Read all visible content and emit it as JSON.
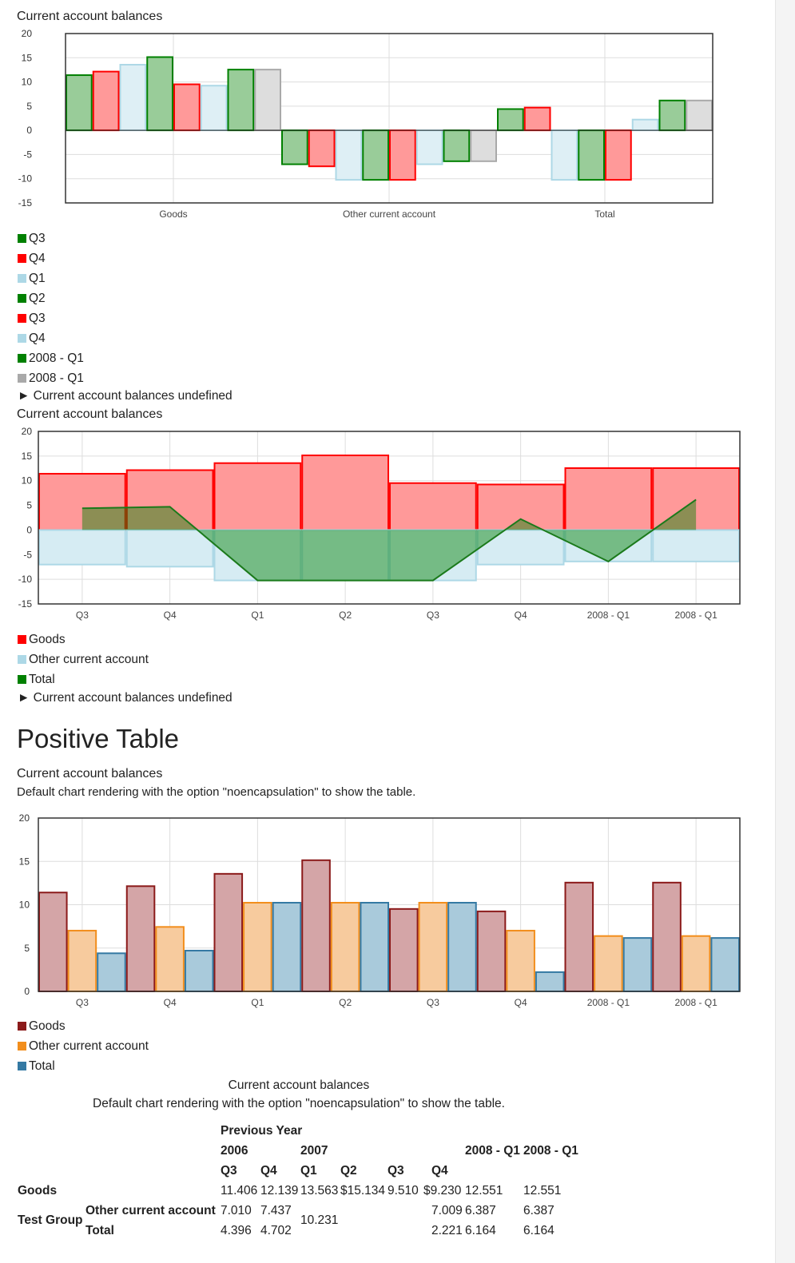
{
  "chart_data": [
    {
      "type": "bar",
      "title": "Current account balances",
      "categories": [
        "Goods",
        "Other current account",
        "Total"
      ],
      "series": [
        {
          "name": "Q3",
          "color": "#008000",
          "values": [
            11.406,
            -7.01,
            4.396
          ]
        },
        {
          "name": "Q4",
          "color": "#ff0000",
          "values": [
            12.139,
            -7.437,
            4.702
          ]
        },
        {
          "name": "Q1",
          "color": "#add8e6",
          "values": [
            13.563,
            -10.231,
            -10.231
          ]
        },
        {
          "name": "Q2",
          "color": "#008000",
          "values": [
            15.134,
            -10.231,
            -10.231
          ]
        },
        {
          "name": "Q3",
          "color": "#ff0000",
          "values": [
            9.51,
            -10.231,
            -10.231
          ]
        },
        {
          "name": "Q4",
          "color": "#add8e6",
          "values": [
            9.23,
            -7.009,
            2.221
          ]
        },
        {
          "name": "2008 - Q1",
          "color": "#008000",
          "values": [
            12.551,
            -6.387,
            6.164
          ]
        },
        {
          "name": "2008 - Q1",
          "color": "#a9a9a9",
          "values": [
            12.551,
            -6.387,
            6.164
          ]
        }
      ],
      "ylim": [
        -15,
        20
      ],
      "yticks": [
        20,
        15,
        10,
        5,
        0,
        -5,
        -10,
        -15
      ],
      "grid": true,
      "legend": "below",
      "undefined_label": "► Current account balances undefined"
    },
    {
      "type": "bar",
      "title": "Current account balances",
      "categories": [
        "Q3",
        "Q4",
        "Q1",
        "Q2",
        "Q3",
        "Q4",
        "2008 - Q1",
        "2008 - Q1"
      ],
      "series": [
        {
          "name": "Goods",
          "kind": "bar",
          "color": "#ff0000",
          "values": [
            11.406,
            12.139,
            13.563,
            15.134,
            9.51,
            9.23,
            12.551,
            12.551
          ]
        },
        {
          "name": "Other current account",
          "kind": "bar",
          "color": "#add8e6",
          "values": [
            -7.01,
            -7.437,
            -10.231,
            -10.231,
            -10.231,
            -7.009,
            -6.387,
            -6.387
          ]
        },
        {
          "name": "Total",
          "kind": "area",
          "color": "#008000",
          "values": [
            4.396,
            4.702,
            -10.231,
            -10.231,
            -10.231,
            2.221,
            -6.387,
            6.164
          ]
        }
      ],
      "ylim": [
        -15,
        20
      ],
      "yticks": [
        20,
        15,
        10,
        5,
        0,
        -5,
        -10,
        -15
      ],
      "grid": true,
      "legend": "below",
      "undefined_label": "► Current account balances undefined"
    },
    {
      "type": "bar",
      "title": "Current account balances",
      "subtitle": "Default chart rendering with the option \"noencapsulation\" to show the table.",
      "categories": [
        "Q3",
        "Q4",
        "Q1",
        "Q2",
        "Q3",
        "Q4",
        "2008 - Q1",
        "2008 - Q1"
      ],
      "series": [
        {
          "name": "Goods",
          "color": "#8b1a1a",
          "fill": "#d4a5a7",
          "values": [
            11.406,
            12.139,
            13.563,
            15.134,
            9.51,
            9.23,
            12.551,
            12.551
          ]
        },
        {
          "name": "Other current account",
          "color": "#f28e1c",
          "fill": "#f7cb9e",
          "values": [
            7.01,
            7.437,
            10.231,
            10.231,
            10.231,
            7.009,
            6.387,
            6.387
          ]
        },
        {
          "name": "Total",
          "color": "#3479a3",
          "fill": "#a9cadb",
          "values": [
            4.396,
            4.702,
            10.231,
            10.231,
            10.231,
            2.221,
            6.164,
            6.164
          ]
        }
      ],
      "ylim": [
        0,
        20
      ],
      "yticks": [
        20,
        15,
        10,
        5,
        0
      ],
      "grid": true,
      "legend": "below"
    }
  ],
  "section_heading": "Positive Table",
  "table": {
    "caption": "Current account balances",
    "subcaption": "Default chart rendering with the option \"noencapsulation\" to show the table.",
    "header_previous_year": "Previous Year",
    "header_2006": "2006",
    "header_2007": "2007",
    "header_2008a": "2008 - Q1",
    "header_2008b": "2008 - Q1",
    "quarters": [
      "Q3",
      "Q4",
      "Q1",
      "Q2",
      "Q3",
      "Q4"
    ],
    "row_goods": {
      "label": "Goods",
      "cells": [
        "11.406",
        "12.139",
        "13.563",
        "$15.134",
        "9.510",
        "$9.230",
        "12.551",
        "12.551"
      ]
    },
    "group_label": "Test Group",
    "row_other": {
      "label": "Other current account",
      "cells": [
        "7.010",
        "7.437",
        "7.009",
        "6.387",
        "6.387"
      ]
    },
    "row_total": {
      "label": "Total",
      "cells": [
        "4.396",
        "4.702",
        "2.221",
        "6.164",
        "6.164"
      ]
    },
    "merged_cell": "10.231"
  }
}
